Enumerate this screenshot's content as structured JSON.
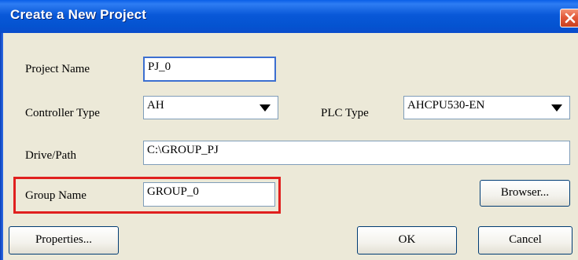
{
  "window": {
    "title": "Create a New Project",
    "close_icon": "close-icon"
  },
  "form": {
    "project_name_label": "Project Name",
    "project_name_value": "PJ_0",
    "controller_type_label": "Controller Type",
    "controller_type_value": "AH",
    "plc_type_label": "PLC Type",
    "plc_type_value": "AHCPU530-EN",
    "drive_path_label": "Drive/Path",
    "drive_path_value": "C:\\GROUP_PJ",
    "group_name_label": "Group Name",
    "group_name_value": "GROUP_0"
  },
  "buttons": {
    "browser": "Browser...",
    "properties": "Properties...",
    "ok": "OK",
    "cancel": "Cancel"
  },
  "colors": {
    "titlebar": "#0453d0",
    "highlight": "#e0201e",
    "dialog_bg": "#ece9d8"
  }
}
